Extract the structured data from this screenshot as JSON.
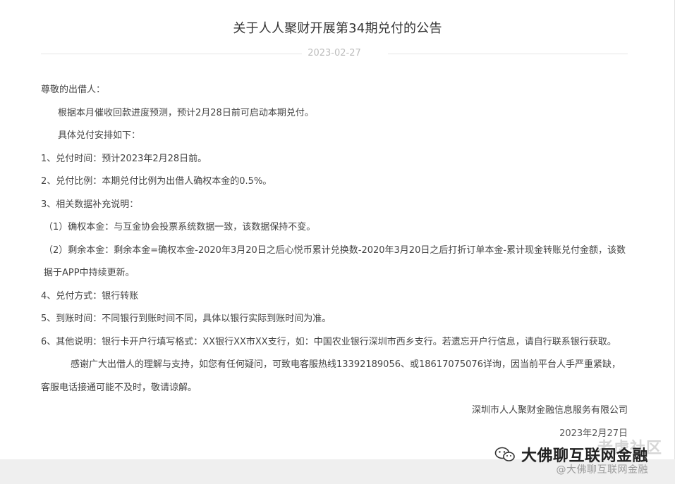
{
  "article": {
    "title": "关于人人聚财开展第34期兑付的公告",
    "date": "2023-02-27",
    "greeting": "尊敬的出借人：",
    "intro": "根据本月催收回款进度预测，预计2月28日前可启动本期兑付。",
    "arrangement_heading": "具体兑付安排如下：",
    "item1": "1、兑付时间：预计2023年2月28日前。",
    "item2": "2、兑付比例：本期兑付比例为出借人确权本金的0.5%。",
    "item3": "3、相关数据补充说明：",
    "sub1": "（1）确权本金：与互金协会投票系统数据一致，该数据保持不变。",
    "sub2": "（2）剩余本金：剩余本金=确权本金-2020年3月20日之后心悦币累计兑换数-2020年3月20日之后打折订单本金-累计现金转账兑付金额，该数据于APP中持续更新。",
    "item4": "4、兑付方式：银行转账",
    "item5": "5、到账时间：不同银行到账时间不同，具体以银行实际到账时间为准。",
    "item6": "6、其他说明：银行卡开户行填写格式：XX银行XX市XX支行，如：中国农业银行深圳市西乡支行。若遗忘开户行信息，请自行联系银行获取。",
    "thanks": "感谢广大出借人的理解与支持，如您有任何疑问，可致电客服热线13392189056、或18617075076详询，因当前平台人手严重紧缺，客服电话接通可能不及时，敬请谅解。",
    "signature": "深圳市人人聚财金融信息服务有限公司",
    "signature_date": "2023年2月27日"
  },
  "watermark": {
    "community": "老虎社区",
    "brand": "大佛聊互联网金融",
    "handle": "@大佛聊互联网金融",
    "icon": "wechat-icon"
  }
}
